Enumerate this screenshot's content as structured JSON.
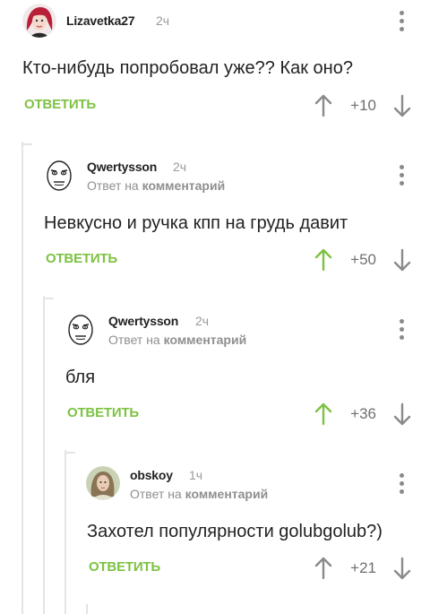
{
  "comments": [
    {
      "author": "Lizavetka27",
      "time": "2ч",
      "reply_prefix": "",
      "reply_target": "",
      "text": "Кто-нибудь попробовал уже?? Как оно?",
      "reply_label": "ОТВЕТИТЬ",
      "score": "+10",
      "upvoted": false,
      "avatar": "avatar-photo-redhead"
    },
    {
      "author": "Qwertysson",
      "time": "2ч",
      "reply_prefix": "Ответ на",
      "reply_target": "комментарий",
      "text": "Невкусно и ручка кпп на грудь давит",
      "reply_label": "ОТВЕТИТЬ",
      "score": "+50",
      "upvoted": true,
      "avatar": "avatar-meme-face"
    },
    {
      "author": "Qwertysson",
      "time": "2ч",
      "reply_prefix": "Ответ на",
      "reply_target": "комментарий",
      "text": "бля",
      "reply_label": "ОТВЕТИТЬ",
      "score": "+36",
      "upvoted": true,
      "avatar": "avatar-meme-face"
    },
    {
      "author": "obskoy",
      "time": "1ч",
      "reply_prefix": "Ответ на",
      "reply_target": "комментарий",
      "text": "Захотел популярности golubgolub?)",
      "reply_label": "ОТВЕТИТЬ",
      "score": "+21",
      "upvoted": false,
      "avatar": "avatar-photo-girl"
    }
  ],
  "colors": {
    "accent_green": "#7dc242",
    "text_dark": "#222222",
    "text_muted": "#9a9a9a",
    "thread_line": "#e4e4e4"
  },
  "icons": [
    "more-vertical-icon",
    "arrow-up-icon",
    "arrow-down-icon"
  ]
}
